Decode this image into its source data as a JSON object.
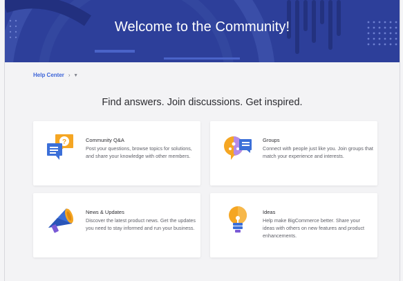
{
  "hero": {
    "title": "Welcome to the Community!"
  },
  "breadcrumb": {
    "home": "Help Center",
    "separator": "›",
    "caret": "▾"
  },
  "tagline": "Find answers. Join discussions. Get inspired.",
  "cards": [
    {
      "icon": "question-chat-icon",
      "title": "Community Q&A",
      "text": "Post your questions, browse topics for solutions, and share your knowledge with other members."
    },
    {
      "icon": "group-chat-icon",
      "title": "Groups",
      "text": "Connect with people just like you. Join groups that match your experience and interests."
    },
    {
      "icon": "megaphone-icon",
      "title": "News & Updates",
      "text": "Discover the latest product news. Get the updates you need to stay informed and run your business."
    },
    {
      "icon": "lightbulb-icon",
      "title": "Ideas",
      "text": "Help make BigCommerce better. Share your ideas with others on new features and product enhancements."
    }
  ],
  "colors": {
    "hero": "#2d3f9a",
    "link": "#3c64d8",
    "orange": "#f5a623",
    "blue": "#3b6fd8",
    "purple": "#7a5ad6"
  }
}
